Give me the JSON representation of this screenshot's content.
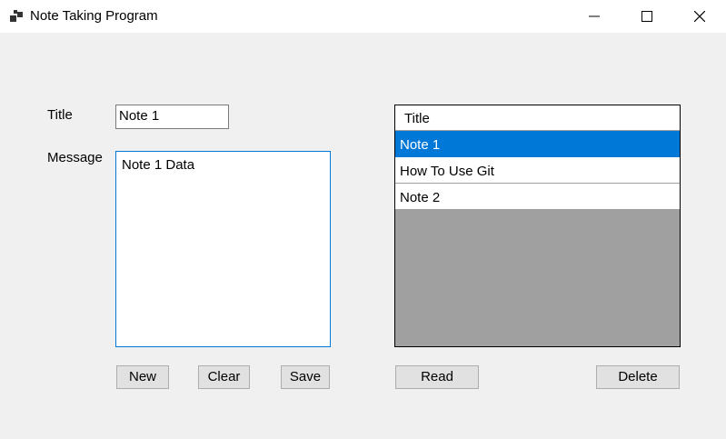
{
  "window": {
    "title": "Note Taking Program",
    "icon": "app-window-icon",
    "controls": [
      "minimize-icon",
      "maximize-icon",
      "close-icon"
    ]
  },
  "form": {
    "title_label": "Title",
    "title_value": "Note 1",
    "message_label": "Message",
    "message_value": "Note 1 Data"
  },
  "buttons": {
    "new": "New",
    "clear": "Clear",
    "save": "Save",
    "read": "Read",
    "delete": "Delete"
  },
  "grid": {
    "header": "Title",
    "rows": [
      "Note 1",
      "How To Use Git",
      "Note 2"
    ],
    "selected_index": 0
  },
  "colors": {
    "selection": "#0078d7",
    "grid_empty": "#a0a0a0",
    "form_background": "#f0f0f0"
  }
}
